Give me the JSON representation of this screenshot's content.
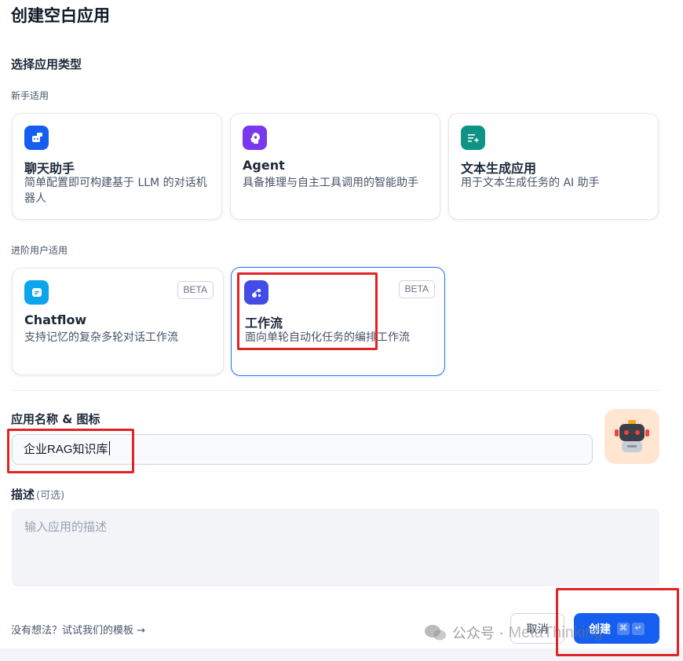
{
  "page": {
    "title": "创建空白应用"
  },
  "app_type": {
    "section_label": "选择应用类型",
    "beginner": {
      "label": "新手适用",
      "cards": [
        {
          "title": "聊天助手",
          "desc": "简单配置即可构建基于 LLM 的对话机器人",
          "icon": "chat-robot-icon",
          "color": "#155eef"
        },
        {
          "title": "Agent",
          "desc": "具备推理与自主工具调用的智能助手",
          "icon": "agent-brain-icon",
          "color": "#7839ee"
        },
        {
          "title": "文本生成应用",
          "desc": "用于文本生成任务的 AI 助手",
          "icon": "text-generation-icon",
          "color": "#0e9384"
        }
      ]
    },
    "advanced": {
      "label": "进阶用户适用",
      "cards": [
        {
          "title": "Chatflow",
          "desc": "支持记忆的复杂多轮对话工作流",
          "badge": "BETA",
          "icon": "chatflow-icon",
          "color": "#0ba5ec"
        },
        {
          "title": "工作流",
          "desc": "面向单轮自动化任务的编排工作流",
          "badge": "BETA",
          "icon": "workflow-icon",
          "color": "#444ce7",
          "selected": true
        }
      ]
    }
  },
  "name_field": {
    "label": "应用名称 & 图标",
    "value": "企业RAG知识库",
    "app_icon": "robot-avatar-icon",
    "app_icon_bg": "#ffe6d2"
  },
  "description_field": {
    "label": "描述",
    "optional": "(可选)",
    "placeholder": "输入应用的描述"
  },
  "footer": {
    "template_link": "没有想法？试试我们的模板",
    "cancel_label": "取消",
    "create_label": "创建",
    "shortcut_cmd": "⌘",
    "shortcut_enter": "↵"
  },
  "watermark": {
    "cn": "公众号 ·",
    "en": "MetaThinking"
  },
  "colors": {
    "primary": "#155eef",
    "highlight_box": "#e02424"
  }
}
